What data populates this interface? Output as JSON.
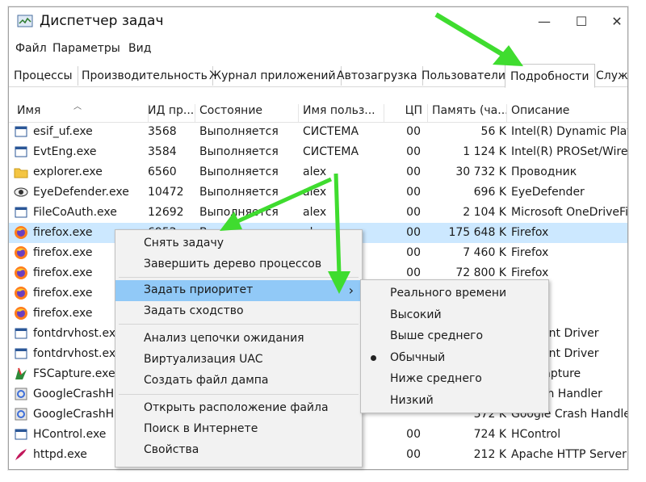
{
  "window": {
    "title": "Диспетчер задач"
  },
  "controls": {
    "minimize": "—",
    "maximize": "☐",
    "close": "✕"
  },
  "menu": [
    "Файл",
    "Параметры",
    "Вид"
  ],
  "tabs": [
    "Процессы",
    "Производительность",
    "Журнал приложений",
    "Автозагрузка",
    "Пользователи",
    "Подробности",
    "Службы"
  ],
  "active_tab": "Подробности",
  "columns": [
    "Имя",
    "ИД пр...",
    "Состояние",
    "Имя польз...",
    "ЦП",
    "Память (ча...",
    "Описание"
  ],
  "rows": [
    {
      "name": "esif_uf.exe",
      "pid": "3568",
      "status": "Выполняется",
      "user": "СИСТЕМА",
      "cpu": "00",
      "mem": "56 K",
      "desc": "Intel(R) Dynamic Platf",
      "icon": "window-icon"
    },
    {
      "name": "EvtEng.exe",
      "pid": "3584",
      "status": "Выполняется",
      "user": "СИСТЕМА",
      "cpu": "00",
      "mem": "1 124 K",
      "desc": "Intel(R) PROSet/Wirele",
      "icon": "window-icon"
    },
    {
      "name": "explorer.exe",
      "pid": "6560",
      "status": "Выполняется",
      "user": "alex",
      "cpu": "00",
      "mem": "30 732 K",
      "desc": "Проводник",
      "icon": "folder-icon"
    },
    {
      "name": "EyeDefender.exe",
      "pid": "10472",
      "status": "Выполняется",
      "user": "alex",
      "cpu": "00",
      "mem": "696 K",
      "desc": "EyeDefender",
      "icon": "eye-icon"
    },
    {
      "name": "FileCoAuth.exe",
      "pid": "12692",
      "status": "Выполняется",
      "user": "alex",
      "cpu": "00",
      "mem": "2 104 K",
      "desc": "Microsoft OneDriveFil",
      "icon": "window-icon"
    },
    {
      "name": "firefox.exe",
      "pid": "6952",
      "status": "Выполняется",
      "user": "alex",
      "cpu": "00",
      "mem": "175 648 K",
      "desc": "Firefox",
      "icon": "firefox-icon",
      "selected": true
    },
    {
      "name": "firefox.exe",
      "pid": "",
      "status": "",
      "user": "",
      "cpu": "00",
      "mem": "7 460 K",
      "desc": "Firefox",
      "icon": "firefox-icon"
    },
    {
      "name": "firefox.exe",
      "pid": "",
      "status": "",
      "user": "",
      "cpu": "00",
      "mem": "72 800 K",
      "desc": "Firefox",
      "icon": "firefox-icon"
    },
    {
      "name": "firefox.exe",
      "pid": "",
      "status": "",
      "user": "",
      "cpu": "",
      "mem": "",
      "desc": "",
      "icon": "firefox-icon"
    },
    {
      "name": "firefox.exe",
      "pid": "",
      "status": "",
      "user": "",
      "cpu": "",
      "mem": "",
      "desc": "",
      "icon": "firefox-icon"
    },
    {
      "name": "fontdrvhost.exe",
      "pid": "",
      "status": "",
      "user": "",
      "cpu": "",
      "mem": "",
      "desc": "ode Font Driver",
      "icon": "window-icon"
    },
    {
      "name": "fontdrvhost.exe",
      "pid": "",
      "status": "",
      "user": "",
      "cpu": "",
      "mem": "",
      "desc": "ode Font Driver",
      "icon": "window-icon"
    },
    {
      "name": "FSCapture.exe",
      "pid": "",
      "status": "",
      "user": "",
      "cpu": "",
      "mem": "",
      "desc": "one Capture",
      "icon": "capture-icon"
    },
    {
      "name": "GoogleCrashHa",
      "pid": "",
      "status": "",
      "user": "",
      "cpu": "",
      "mem": "",
      "desc": "e Crash Handler",
      "icon": "google-icon"
    },
    {
      "name": "GoogleCrashHa",
      "pid": "",
      "status": "",
      "user": "",
      "cpu": "",
      "mem": "372 K",
      "desc": "Google Crash Handler",
      "icon": "google-icon"
    },
    {
      "name": "HControl.exe",
      "pid": "",
      "status": "",
      "user": "",
      "cpu": "00",
      "mem": "724 K",
      "desc": "HControl",
      "icon": "window-icon"
    },
    {
      "name": "httpd.exe",
      "pid": "",
      "status": "",
      "user": "",
      "cpu": "00",
      "mem": "212 K",
      "desc": "Apache HTTP Server",
      "icon": "feather-icon"
    }
  ],
  "context_menu": {
    "items": [
      "Снять задачу",
      "Завершить дерево процессов",
      "Задать приоритет",
      "Задать сходство",
      "Анализ цепочки ожидания",
      "Виртуализация UAC",
      "Создать файл дампа",
      "Открыть расположение файла",
      "Поиск в Интернете",
      "Свойства"
    ],
    "hovered": "Задать приоритет",
    "submenu_arrow": "›"
  },
  "priority_submenu": {
    "items": [
      "Реального времени",
      "Высокий",
      "Выше среднего",
      "Обычный",
      "Ниже среднего",
      "Низкий"
    ],
    "selected": "Обычный"
  },
  "colors": {
    "selected_row": "#cce8ff",
    "menu_hover": "#91c9f7",
    "arrow": "#3fdc2f"
  }
}
